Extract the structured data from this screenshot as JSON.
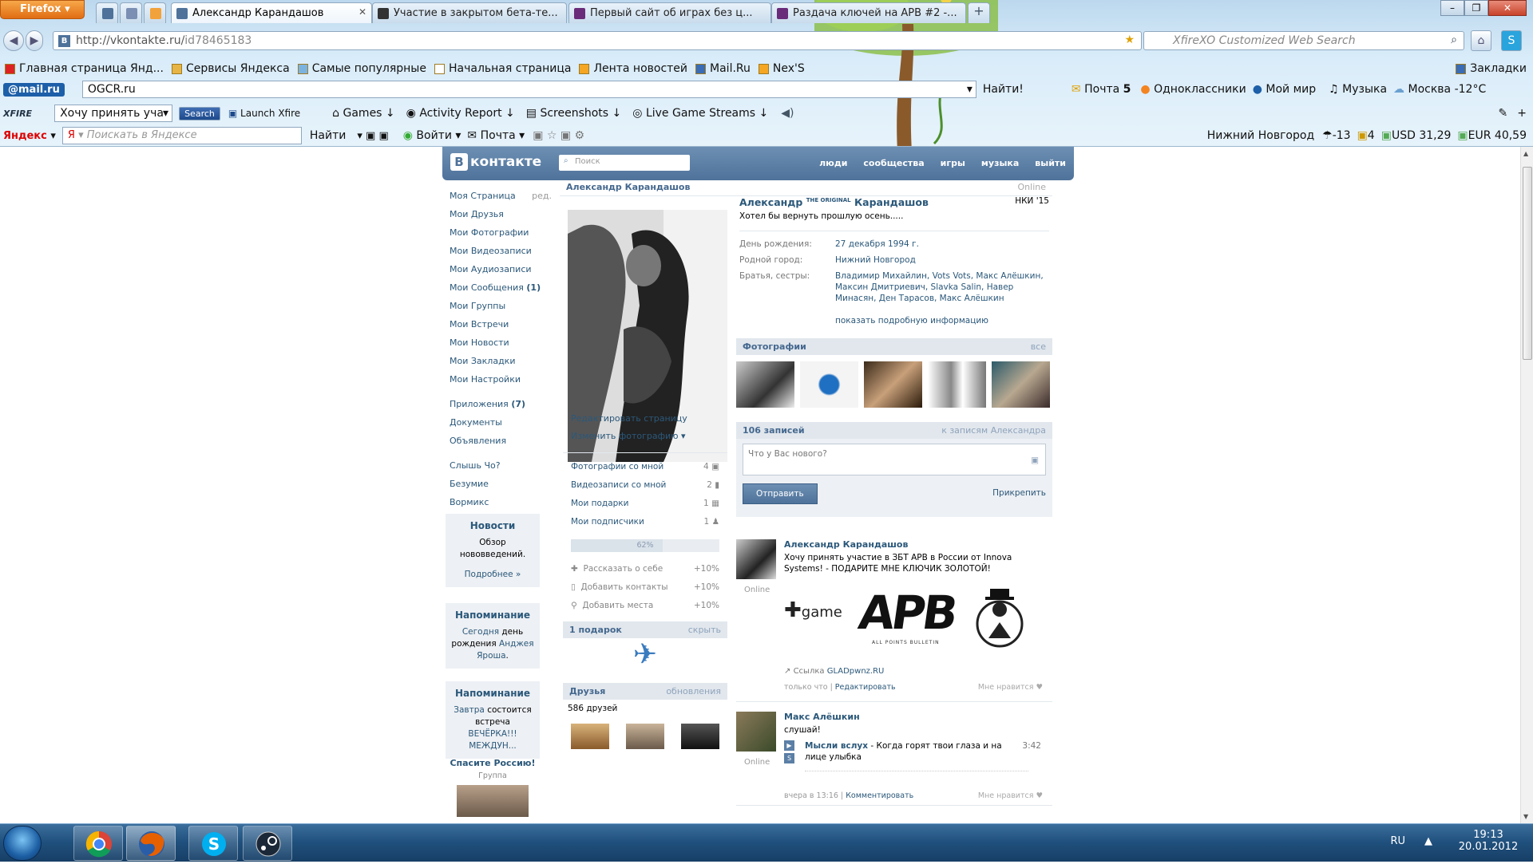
{
  "browser": {
    "app_button": "Firefox",
    "tabs": [
      {
        "title": "Александр Карандашов",
        "active": true
      },
      {
        "title": "Участие в закрытом бета-те...",
        "active": false
      },
      {
        "title": "Первый сайт об играх без ц...",
        "active": false
      },
      {
        "title": "Раздача ключей на APB #2 -...",
        "active": false
      }
    ],
    "new_tab": "+",
    "url_host": "http://vkontakte.ru/",
    "url_path": "id78465183",
    "search_placeholder": "XfireXO Customized Web Search",
    "bookmarks": [
      "Главная страница Янд...",
      "Сервисы Яндекса",
      "Самые популярные",
      "Начальная страница",
      "Лента новостей",
      "Mail.Ru",
      "Nex'S"
    ],
    "bookmarks_menu": "Закладки",
    "mailru_bar": {
      "logo": "@mail.ru",
      "input_value": "OGCR.ru",
      "find": "Найти!",
      "mail": "Почта",
      "mail_count": "5",
      "ok": "Одноклассники",
      "myworld": "Мой мир",
      "music": "Музыка",
      "weather": "Москва -12°C"
    },
    "xfire_bar": {
      "logo": "XFIRE",
      "status_value": "Хочу принять уча",
      "search_btn": "Search",
      "launch": "Launch Xfire",
      "games": "Games",
      "activity": "Activity Report",
      "screenshots": "Screenshots",
      "streams": "Live Game Streams"
    },
    "yandex_bar": {
      "logo": "Яндекс",
      "search_placeholder": "Поискать в Яндексе",
      "find": "Найти",
      "login": "Войти",
      "mail": "Почта",
      "city": "Нижний Новгород",
      "temp": "-13",
      "traffic": "4",
      "usd": "USD 31,29",
      "eur": "EUR 40,59"
    }
  },
  "vk": {
    "logo": "контакте",
    "logo_letter": "В",
    "search_placeholder": "Поиск",
    "nav": [
      "люди",
      "сообщества",
      "игры",
      "музыка",
      "выйти"
    ],
    "menu": [
      {
        "label": "Моя Страница",
        "extra": "ред."
      },
      {
        "label": "Мои Друзья"
      },
      {
        "label": "Мои Фотографии"
      },
      {
        "label": "Мои Видеозаписи"
      },
      {
        "label": "Мои Аудиозаписи"
      },
      {
        "label": "Мои Сообщения",
        "count": "(1)"
      },
      {
        "label": "Мои Группы"
      },
      {
        "label": "Мои Встречи"
      },
      {
        "label": "Мои Новости"
      },
      {
        "label": "Мои Закладки"
      },
      {
        "label": "Мои Настройки"
      }
    ],
    "menu2": [
      {
        "label": "Приложения",
        "count": "(7)"
      },
      {
        "label": "Документы"
      },
      {
        "label": "Объявления"
      }
    ],
    "menu3": [
      "Слышь Чо?",
      "Безумие",
      "Вормикс"
    ],
    "news_box": {
      "title": "Новости",
      "text": "Обзор нововведений.",
      "more": "Подробнее »"
    },
    "remind1": {
      "title": "Напоминание",
      "t1": "Сегодня",
      "t2": "день",
      "t3": "рождения",
      "name": "Анджея Яроша",
      "dot": "."
    },
    "remind2": {
      "title": "Напоминание",
      "t1": "Завтра",
      "t2": "состоится встреча",
      "event": "ВЕЧЁРКА!!! МЕЖДУН..."
    },
    "group_ad": {
      "title": "Спасите Россию!",
      "sub": "Группа"
    },
    "profile": {
      "name_bar": "Александр Карандашов",
      "online": "Online",
      "name_first": "Александр",
      "name_mid": "THE ORIGINAL",
      "name_last": "Карандашов",
      "school": "НКИ '15",
      "status": "Хотел бы вернуть прошлую осень.....",
      "info": [
        {
          "k": "День рождения:",
          "v": "27 декабря 1994 г."
        },
        {
          "k": "Родной город:",
          "v": "Нижний Новгород"
        },
        {
          "k": "Братья, сестры:",
          "v": "Владимир Михайлин, Vots Vots, Макс Алёшкин, Максин Дмитриевич, Slavka Salin, Навер Минасян, Ден Тарасов, Макс Алёшкин"
        }
      ],
      "show_more": "показать подробную информацию",
      "photos_title": "Фотографии",
      "photos_all": "все",
      "edit_page": "Редактировать страницу",
      "change_photo": "Изменить фотографию",
      "stats": [
        {
          "label": "Фотографии со мной",
          "n": "4"
        },
        {
          "label": "Видеозаписи со мной",
          "n": "2"
        },
        {
          "label": "Мои подарки",
          "n": "1"
        },
        {
          "label": "Мои подписчики",
          "n": "1"
        }
      ],
      "progress": "62%",
      "progress_value": 0.62,
      "tasks": [
        {
          "label": "Рассказать о себе",
          "p": "+10%"
        },
        {
          "label": "Добавить контакты",
          "p": "+10%"
        },
        {
          "label": "Добавить места",
          "p": "+10%"
        }
      ],
      "gifts_title": "1 подарок",
      "gifts_hide": "скрыть",
      "friends_title": "Друзья",
      "friends_updates": "обновления",
      "friends_count": "586 друзей",
      "wall_title": "106 записей",
      "wall_link": "к записям Александра",
      "wall_placeholder": "Что у Вас нового?",
      "send": "Отправить",
      "attach": "Прикрепить"
    },
    "posts": [
      {
        "author": "Александр Карандашов",
        "text": "Хочу принять участие в ЗБТ APB в России от Innova Systems! - ПОДАРИТЕ МНЕ КЛЮЧИК ЗОЛОТОЙ!",
        "online": "Online",
        "img_game": "game",
        "img_apb": "APB",
        "img_apb_sub": "ALL POINTS BULLETIN",
        "link_prefix": "Ссылка",
        "link": "GLADpwnz.RU",
        "time": "только что",
        "action": "Редактировать",
        "like": "Мне нравится"
      },
      {
        "author": "Макс Алёшкин",
        "text": "слушай!",
        "online": "Online",
        "audio_title": "Мысли вслух",
        "audio_name": "Когда горят твои глаза и на лице улыбка",
        "audio_time": "3:42",
        "time": "вчера в 13:16",
        "action": "Комментировать",
        "like": "Мне нравится"
      }
    ]
  },
  "taskbar": {
    "lang": "RU",
    "time": "19:13",
    "date": "20.01.2012"
  }
}
